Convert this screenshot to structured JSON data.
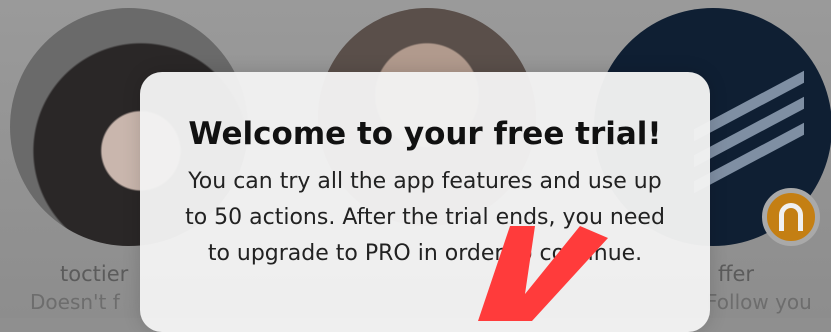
{
  "profiles": [
    {
      "name": "toctier",
      "status": "Doesn't f"
    },
    {
      "name": "",
      "status": ""
    },
    {
      "name": "ffer",
      "status": "Follow you"
    }
  ],
  "dialog": {
    "title": "Welcome to your free trial!",
    "body": "You can try all the app features and use up to 50 actions. After the trial ends, you need to upgrade to PRO in order to continue."
  },
  "colors": {
    "overlay_background": "#8f8f8f",
    "dialog_background": "#f2f2f2",
    "annotation_arrow": "#ff3b3b",
    "badge": "#c47f13"
  },
  "icons": [
    "headphones-icon",
    "annotation-arrow-icon"
  ]
}
